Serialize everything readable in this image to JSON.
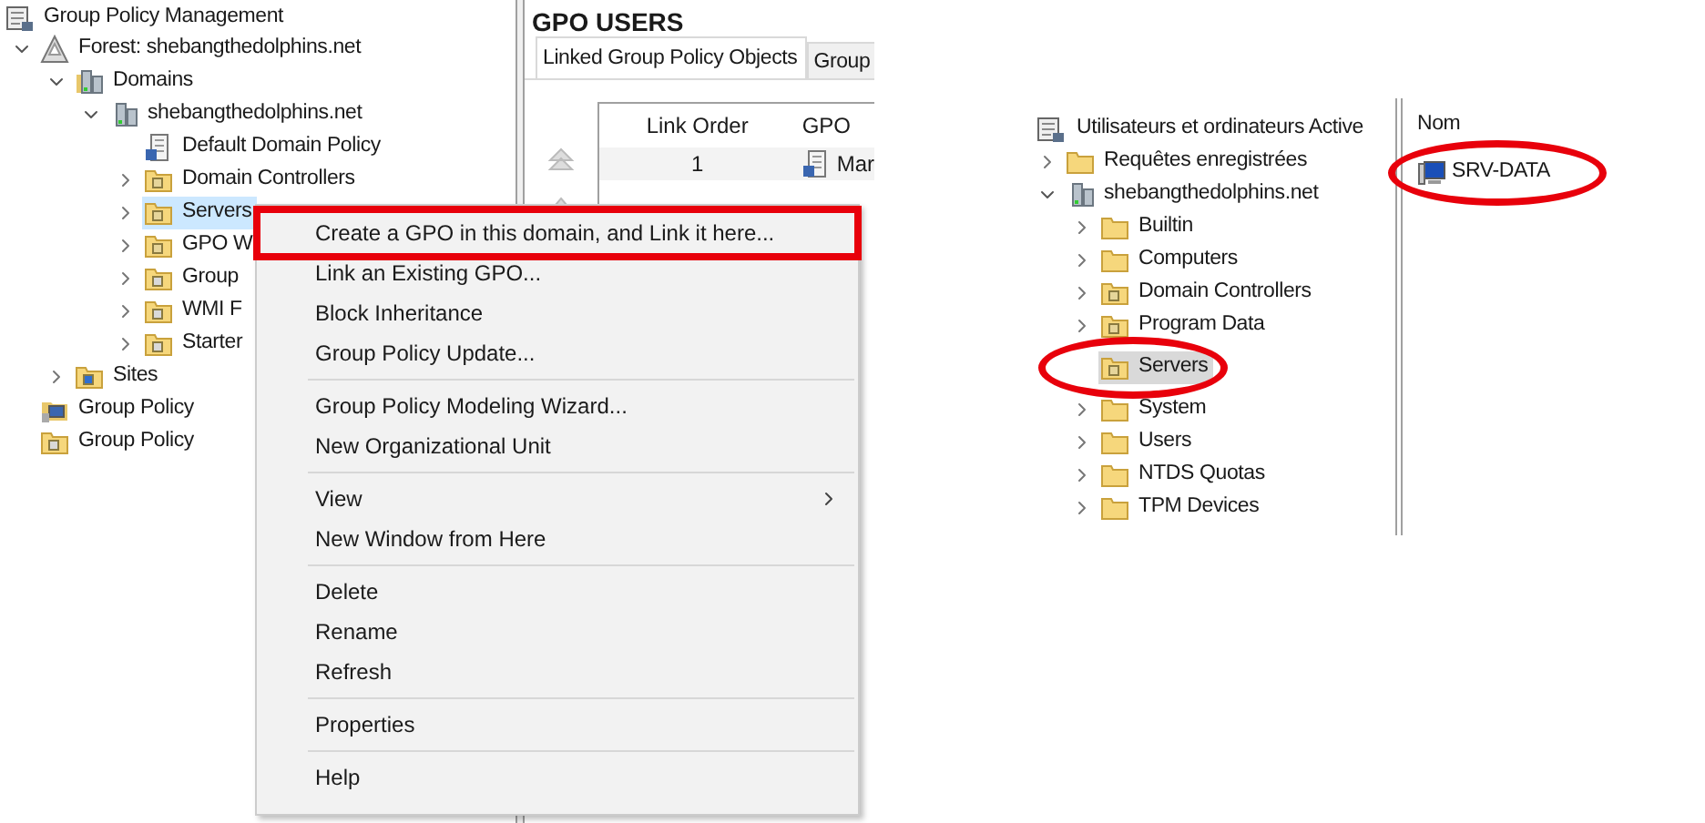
{
  "left_tree": {
    "title": "Group Policy Management",
    "items": [
      {
        "label": "Forest: shebangthedolphins.net",
        "kind": "forest",
        "toggle": true,
        "expanded": true,
        "selected": false,
        "children": [
          {
            "label": "Domains",
            "kind": "domains",
            "toggle": true,
            "expanded": true,
            "selected": false,
            "children": [
              {
                "label": "shebangthedolphins.net",
                "kind": "domain",
                "toggle": true,
                "expanded": true,
                "selected": false,
                "children": [
                  {
                    "label": "Default Domain Policy",
                    "kind": "gpo",
                    "toggle": false,
                    "expanded": false,
                    "selected": false
                  },
                  {
                    "label": "Domain Controllers",
                    "kind": "ou",
                    "toggle": true,
                    "expanded": false,
                    "selected": false
                  },
                  {
                    "label": "Servers",
                    "kind": "ou",
                    "toggle": true,
                    "expanded": false,
                    "selected": true
                  },
                  {
                    "label": "GPO W",
                    "kind": "ou",
                    "toggle": true,
                    "expanded": false,
                    "selected": false
                  },
                  {
                    "label": "Group",
                    "kind": "gpofolder",
                    "toggle": true,
                    "expanded": false,
                    "selected": false
                  },
                  {
                    "label": "WMI F",
                    "kind": "wmi",
                    "toggle": true,
                    "expanded": false,
                    "selected": false
                  },
                  {
                    "label": "Starter",
                    "kind": "starter",
                    "toggle": true,
                    "expanded": false,
                    "selected": false
                  }
                ]
              }
            ]
          },
          {
            "label": "Sites",
            "kind": "sites",
            "toggle": true,
            "expanded": false,
            "selected": false
          }
        ]
      },
      {
        "label": "Group Policy",
        "kind": "modeling",
        "toggle": false,
        "expanded": false,
        "selected": false
      },
      {
        "label": "Group Policy",
        "kind": "results",
        "toggle": false,
        "expanded": false,
        "selected": false
      }
    ]
  },
  "gpo_pane": {
    "title": "GPO USERS",
    "tabs": [
      {
        "label": "Linked Group Policy Objects",
        "selected": true
      },
      {
        "label": "Group",
        "selected": false
      }
    ],
    "columns": [
      "Link Order",
      "GPO"
    ],
    "rows": [
      {
        "link_order": "1",
        "gpo": "Mar"
      }
    ]
  },
  "context_menu": {
    "groups": [
      [
        {
          "label": "Create a GPO in this domain, and Link it here...",
          "submenu": false,
          "marked": true
        },
        {
          "label": "Link an Existing GPO...",
          "submenu": false,
          "marked": false
        },
        {
          "label": "Block Inheritance",
          "submenu": false,
          "marked": false
        },
        {
          "label": "Group Policy Update...",
          "submenu": false,
          "marked": false
        }
      ],
      [
        {
          "label": "Group Policy Modeling Wizard...",
          "submenu": false,
          "marked": false
        },
        {
          "label": "New Organizational Unit",
          "submenu": false,
          "marked": false
        }
      ],
      [
        {
          "label": "View",
          "submenu": true,
          "marked": false
        },
        {
          "label": "New Window from Here",
          "submenu": false,
          "marked": false
        }
      ],
      [
        {
          "label": "Delete",
          "submenu": false,
          "marked": false
        },
        {
          "label": "Rename",
          "submenu": false,
          "marked": false
        },
        {
          "label": "Refresh",
          "submenu": false,
          "marked": false
        }
      ],
      [
        {
          "label": "Properties",
          "submenu": false,
          "marked": false
        }
      ],
      [
        {
          "label": "Help",
          "submenu": false,
          "marked": false
        }
      ]
    ]
  },
  "ad_tree": {
    "title": "Utilisateurs et ordinateurs Active",
    "items": [
      {
        "label": "Requêtes enregistrées",
        "kind": "folder",
        "toggle": true,
        "expanded": false,
        "selected": false,
        "circled": false
      },
      {
        "label": "shebangthedolphins.net",
        "kind": "domain",
        "toggle": true,
        "expanded": true,
        "selected": false,
        "circled": false,
        "children": [
          {
            "label": "Builtin",
            "kind": "folder",
            "toggle": true,
            "expanded": false,
            "selected": false,
            "circled": false
          },
          {
            "label": "Computers",
            "kind": "folder",
            "toggle": true,
            "expanded": false,
            "selected": false,
            "circled": false
          },
          {
            "label": "Domain Controllers",
            "kind": "ou",
            "toggle": true,
            "expanded": false,
            "selected": false,
            "circled": false
          },
          {
            "label": "Program Data",
            "kind": "ou",
            "toggle": true,
            "expanded": false,
            "selected": false,
            "circled": false
          },
          {
            "label": "Servers",
            "kind": "ou",
            "toggle": false,
            "expanded": false,
            "selected": true,
            "circled": true
          },
          {
            "label": "System",
            "kind": "folder",
            "toggle": true,
            "expanded": false,
            "selected": false,
            "circled": false
          },
          {
            "label": "Users",
            "kind": "folder",
            "toggle": true,
            "expanded": false,
            "selected": false,
            "circled": false
          },
          {
            "label": "NTDS Quotas",
            "kind": "folder",
            "toggle": true,
            "expanded": false,
            "selected": false,
            "circled": false
          },
          {
            "label": "TPM Devices",
            "kind": "folder",
            "toggle": true,
            "expanded": false,
            "selected": false,
            "circled": false
          }
        ]
      }
    ]
  },
  "ad_list": {
    "column": "Nom",
    "items": [
      {
        "label": "SRV-DATA",
        "circled": true
      }
    ]
  }
}
